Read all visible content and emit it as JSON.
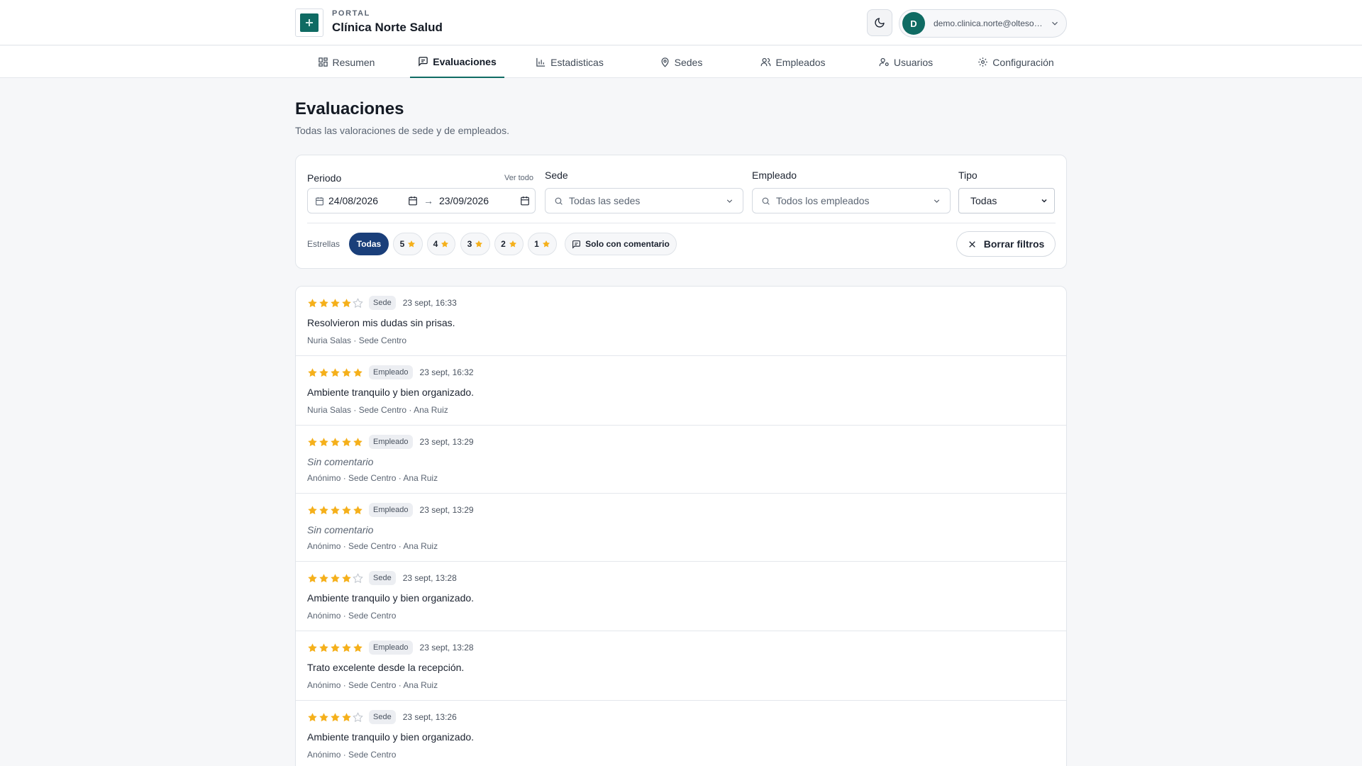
{
  "header": {
    "kicker": "PORTAL",
    "clinic_name": "Clínica Norte Salud",
    "user_initial": "D",
    "user_email": "demo.clinica.norte@oltesoft.com"
  },
  "nav": {
    "tabs": [
      {
        "label": "Resumen",
        "icon": "grid-icon"
      },
      {
        "label": "Evaluaciones",
        "icon": "message-square-icon",
        "active": true
      },
      {
        "label": "Estadisticas",
        "icon": "bar-chart-icon"
      },
      {
        "label": "Sedes",
        "icon": "map-pin-icon"
      },
      {
        "label": "Empleados",
        "icon": "users-icon"
      },
      {
        "label": "Usuarios",
        "icon": "user-cog-icon"
      },
      {
        "label": "Configuración",
        "icon": "gear-icon"
      }
    ]
  },
  "page": {
    "title": "Evaluaciones",
    "subtitle": "Todas las valoraciones de sede y de empleados."
  },
  "filters": {
    "period_label": "Periodo",
    "see_all": "Ver todo",
    "date_from": "24/08/2026",
    "date_arrow": "→",
    "date_to": "23/09/2026",
    "site_label": "Sede",
    "site_placeholder": "Todas las sedes",
    "employee_label": "Empleado",
    "employee_placeholder": "Todos los empleados",
    "type_label": "Tipo",
    "type_value": "Todas",
    "stars_label": "Estrellas",
    "star_chips": [
      "Todas",
      "5",
      "4",
      "3",
      "2",
      "1"
    ],
    "comment_only": "Solo con comentario",
    "clear": "Borrar filtros"
  },
  "colors": {
    "star": "#f5b01b",
    "accent": "#0f6b63",
    "chip_active": "#1a3f7a"
  },
  "reviews": [
    {
      "rating": 4,
      "type": "Sede",
      "time": "23 sept, 16:33",
      "comment": "Resolvieron mis dudas sin prisas.",
      "meta": "Nuria Salas · Sede Centro"
    },
    {
      "rating": 5,
      "type": "Empleado",
      "time": "23 sept, 16:32",
      "comment": "Ambiente tranquilo y bien organizado.",
      "meta": "Nuria Salas · Sede Centro · Ana Ruiz"
    },
    {
      "rating": 5,
      "type": "Empleado",
      "time": "23 sept, 13:29",
      "comment": "Sin comentario",
      "no_comment": true,
      "meta": "Anónimo · Sede Centro · Ana Ruiz"
    },
    {
      "rating": 5,
      "type": "Empleado",
      "time": "23 sept, 13:29",
      "comment": "Sin comentario",
      "no_comment": true,
      "meta": "Anónimo · Sede Centro · Ana Ruiz"
    },
    {
      "rating": 4,
      "type": "Sede",
      "time": "23 sept, 13:28",
      "comment": "Ambiente tranquilo y bien organizado.",
      "meta": "Anónimo · Sede Centro"
    },
    {
      "rating": 5,
      "type": "Empleado",
      "time": "23 sept, 13:28",
      "comment": "Trato excelente desde la recepción.",
      "meta": "Anónimo · Sede Centro · Ana Ruiz"
    },
    {
      "rating": 4,
      "type": "Sede",
      "time": "23 sept, 13:26",
      "comment": "Ambiente tranquilo y bien organizado.",
      "meta": "Anónimo · Sede Centro"
    }
  ]
}
